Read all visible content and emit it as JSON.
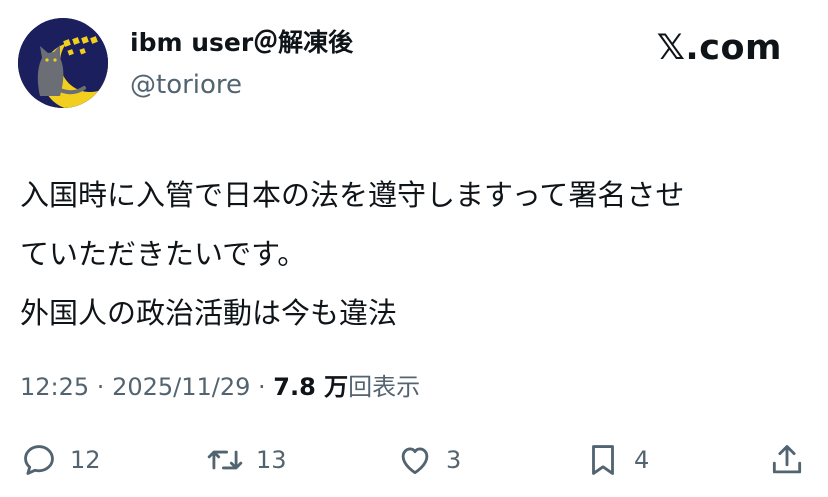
{
  "author": {
    "display_name": "ibm user＠解凍後",
    "handle": "@toriore",
    "avatar_icon": "cat-moon-avatar-icon"
  },
  "brand": {
    "label": "𝕏.com",
    "accent": "#0f1419"
  },
  "tweet": {
    "lines": [
      "入国時に入管で日本の法を遵守しますって署名させ",
      "ていただきたいです。",
      "外国人の政治活動は今も違法"
    ]
  },
  "meta": {
    "time": "12:25",
    "separator": " · ",
    "date": "2025/11/29",
    "views_count": "7.8 万",
    "views_label": "回表示"
  },
  "actions": {
    "reply": {
      "icon": "reply-icon",
      "count": "12"
    },
    "retweet": {
      "icon": "retweet-icon",
      "count": "13"
    },
    "like": {
      "icon": "heart-icon",
      "count": "3"
    },
    "bookmark": {
      "icon": "bookmark-icon",
      "count": "4"
    },
    "share": {
      "icon": "share-icon"
    }
  },
  "colors": {
    "text_primary": "#0f1419",
    "text_secondary": "#536471",
    "avatar_background": "#1b1f5e",
    "moon": "#f2cf1f"
  }
}
